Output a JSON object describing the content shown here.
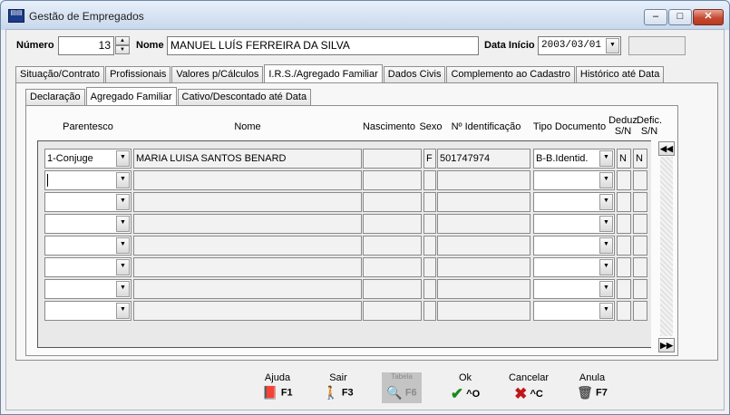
{
  "window": {
    "title": "Gestão de Empregados",
    "min_glyph": "‒",
    "max_glyph": "□",
    "close_glyph": "✕"
  },
  "header": {
    "numero_label": "Número",
    "numero_value": "13",
    "nome_label": "Nome",
    "nome_value": "MANUEL LUÍS FERREIRA DA SILVA",
    "data_inicio_label": "Data Início",
    "data_inicio_value": "2003/03/01"
  },
  "main_tabs": [
    {
      "label": "Situação/Contrato"
    },
    {
      "label": "Profissionais"
    },
    {
      "label": "Valores p/Cálculos"
    },
    {
      "label": "I.R.S./Agregado Familiar"
    },
    {
      "label": "Dados Civis"
    },
    {
      "label": "Complemento ao Cadastro"
    },
    {
      "label": "Histórico até Data"
    }
  ],
  "sub_tabs": [
    {
      "label": "Declaração"
    },
    {
      "label": "Agregado Familiar"
    },
    {
      "label": "Cativo/Descontado até Data"
    }
  ],
  "columns": {
    "parentesco": "Parentesco",
    "nome": "Nome",
    "nascimento": "Nascimento",
    "sexo": "Sexo",
    "identificacao": "Nº Identificação",
    "tipo_documento": "Tipo Documento",
    "deduz_1": "Deduz",
    "deduz_2": "S/N",
    "defic_1": "Defic.",
    "defic_2": "S/N"
  },
  "rows": [
    {
      "parentesco": "1-Conjuge",
      "nome": "MARIA LUISA SANTOS BENARD",
      "nascimento": "",
      "sexo": "F",
      "identificacao": "501747974",
      "tipo_documento": "B-B.Identid.",
      "deduz": "N",
      "defic": "N"
    },
    {
      "parentesco": "",
      "nome": "",
      "nascimento": "",
      "sexo": "",
      "identificacao": "",
      "tipo_documento": "",
      "deduz": "",
      "defic": ""
    },
    {
      "parentesco": "",
      "nome": "",
      "nascimento": "",
      "sexo": "",
      "identificacao": "",
      "tipo_documento": "",
      "deduz": "",
      "defic": ""
    },
    {
      "parentesco": "",
      "nome": "",
      "nascimento": "",
      "sexo": "",
      "identificacao": "",
      "tipo_documento": "",
      "deduz": "",
      "defic": ""
    },
    {
      "parentesco": "",
      "nome": "",
      "nascimento": "",
      "sexo": "",
      "identificacao": "",
      "tipo_documento": "",
      "deduz": "",
      "defic": ""
    },
    {
      "parentesco": "",
      "nome": "",
      "nascimento": "",
      "sexo": "",
      "identificacao": "",
      "tipo_documento": "",
      "deduz": "",
      "defic": ""
    },
    {
      "parentesco": "",
      "nome": "",
      "nascimento": "",
      "sexo": "",
      "identificacao": "",
      "tipo_documento": "",
      "deduz": "",
      "defic": ""
    },
    {
      "parentesco": "",
      "nome": "",
      "nascimento": "",
      "sexo": "",
      "identificacao": "",
      "tipo_documento": "",
      "deduz": "",
      "defic": ""
    }
  ],
  "scroll": {
    "up_glyph": "◀◀",
    "down_glyph": "▶▶"
  },
  "toolbar": [
    {
      "label": "Ajuda",
      "key": "F1",
      "icon": "book-icon",
      "glyph": "📕",
      "color": "#8b2f6b"
    },
    {
      "label": "Sair",
      "key": "F3",
      "icon": "exit-icon",
      "glyph": "🚶",
      "color": "#1b3c8a"
    },
    {
      "label": "Tabela",
      "key": "F6",
      "icon": "table-search-icon",
      "glyph": "🔍",
      "color": "#777777"
    },
    {
      "label": "Ok",
      "key": "^O",
      "icon": "check-icon",
      "glyph": "✔",
      "color": "#1a8a1a"
    },
    {
      "label": "Cancelar",
      "key": "^C",
      "icon": "cancel-icon",
      "glyph": "✖",
      "color": "#c0161a"
    },
    {
      "label": "Anula",
      "key": "F7",
      "icon": "trash-icon",
      "glyph": "🗑",
      "color": "#555555"
    }
  ]
}
